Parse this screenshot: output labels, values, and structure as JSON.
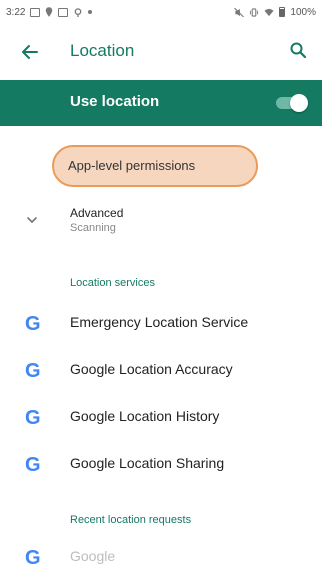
{
  "status_bar": {
    "time": "3:22",
    "battery": "100%",
    "icons": [
      "gallery-icon",
      "location-pin-icon",
      "gallery-icon",
      "pin-icon",
      "dot-icon",
      "mute-icon",
      "vibrate-icon",
      "wifi-icon",
      "battery-icon"
    ]
  },
  "app_bar": {
    "title": "Location",
    "back_icon": "arrow-back-icon",
    "search_icon": "search-icon"
  },
  "master_switch": {
    "label": "Use location",
    "state": "on"
  },
  "permissions_item": {
    "label": "App-level permissions"
  },
  "advanced": {
    "title": "Advanced",
    "subtitle": "Scanning"
  },
  "location_services": {
    "header": "Location services",
    "items": [
      {
        "label": "Emergency Location Service",
        "icon": "google-g-icon"
      },
      {
        "label": "Google Location Accuracy",
        "icon": "google-g-icon"
      },
      {
        "label": "Google Location History",
        "icon": "google-g-icon"
      },
      {
        "label": "Google Location Sharing",
        "icon": "google-g-icon"
      }
    ]
  },
  "recent_requests": {
    "header": "Recent location requests",
    "items": [
      {
        "label": "Google",
        "icon": "google-g-icon"
      }
    ]
  },
  "colors": {
    "accent": "#147a64",
    "master_bg": "#157a62",
    "highlight_fill": "#f6d6bf",
    "highlight_border": "#e89c5c"
  }
}
